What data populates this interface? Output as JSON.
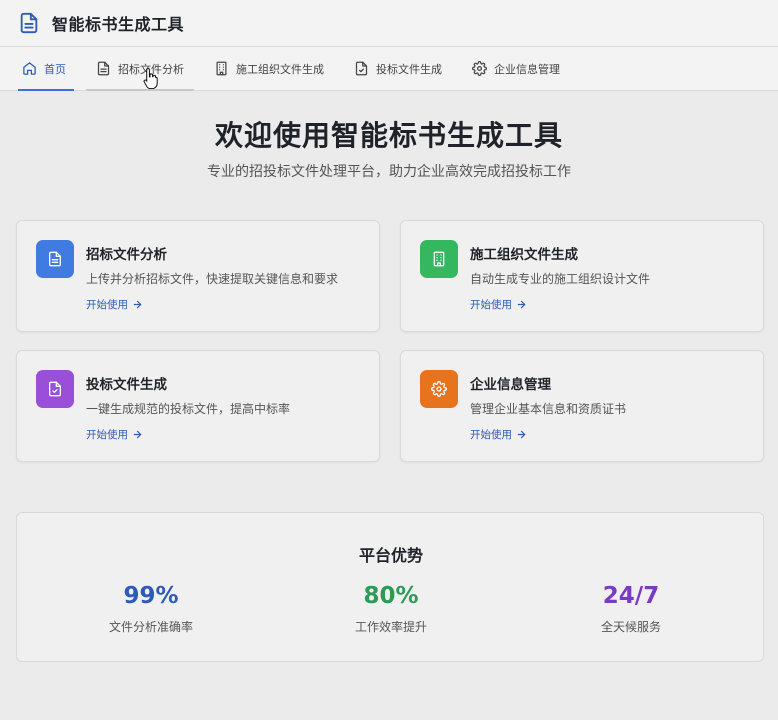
{
  "app": {
    "title": "智能标书生成工具"
  },
  "nav": [
    {
      "label": "首页",
      "icon": "home-icon"
    },
    {
      "label": "招标文件分析",
      "icon": "document-icon"
    },
    {
      "label": "施工组织文件生成",
      "icon": "building-icon"
    },
    {
      "label": "投标文件生成",
      "icon": "file-check-icon"
    },
    {
      "label": "企业信息管理",
      "icon": "gear-icon"
    }
  ],
  "hero": {
    "title": "欢迎使用智能标书生成工具",
    "subtitle": "专业的招投标文件处理平台，助力企业高效完成招投标工作"
  },
  "cards": [
    {
      "title": "招标文件分析",
      "desc": "上传并分析招标文件，快速提取关键信息和要求",
      "link": "开始使用",
      "color": "#3f7be0",
      "icon": "document-icon"
    },
    {
      "title": "施工组织文件生成",
      "desc": "自动生成专业的施工组织设计文件",
      "link": "开始使用",
      "color": "#35b75f",
      "icon": "building-icon"
    },
    {
      "title": "投标文件生成",
      "desc": "一键生成规范的投标文件，提高中标率",
      "link": "开始使用",
      "color": "#9a4fd9",
      "icon": "file-check-icon"
    },
    {
      "title": "企业信息管理",
      "desc": "管理企业基本信息和资质证书",
      "link": "开始使用",
      "color": "#e8731f",
      "icon": "gear-icon"
    }
  ],
  "advantages": {
    "title": "平台优势",
    "items": [
      {
        "value": "99%",
        "label": "文件分析准确率",
        "color": "#2d5bb8"
      },
      {
        "value": "80%",
        "label": "工作效率提升",
        "color": "#2e9a55"
      },
      {
        "value": "24/7",
        "label": "全天候服务",
        "color": "#7a3bc4"
      }
    ]
  }
}
